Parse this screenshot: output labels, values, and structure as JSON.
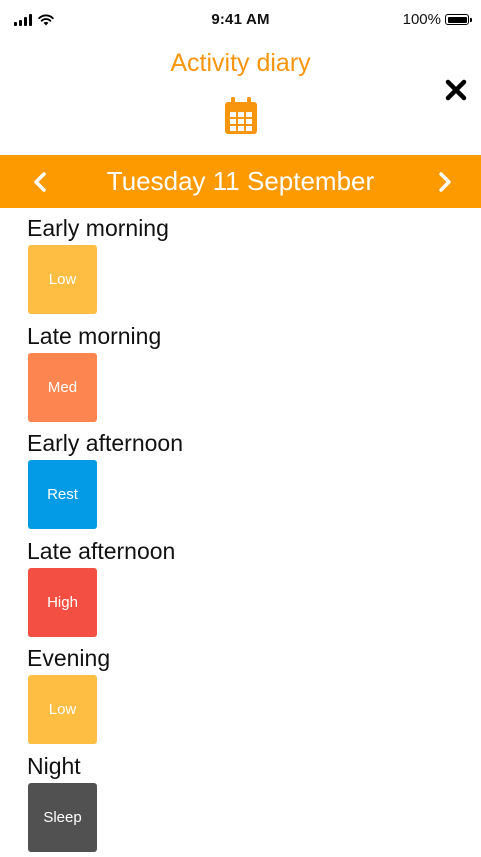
{
  "status_bar": {
    "time": "9:41 AM",
    "battery": "100%",
    "icons": [
      "signal-icon",
      "wifi-icon",
      "battery-icon"
    ]
  },
  "header": {
    "title": "Activity diary",
    "close_icon": "close-icon",
    "calendar_icon": "calendar-icon"
  },
  "date_nav": {
    "date": "Tuesday 11 September",
    "prev_icon": "chevron-left-icon",
    "next_icon": "chevron-right-icon"
  },
  "colors": {
    "accent": "#f7960e",
    "bar": "#fd9a00",
    "low": "#fdbe43",
    "med": "#fd8550",
    "rest": "#039be5",
    "high": "#f44f43",
    "sleep": "#515151"
  },
  "periods": [
    {
      "label": "Early morning",
      "level": "Low",
      "color": "#fdbe43"
    },
    {
      "label": "Late morning",
      "level": "Med",
      "color": "#fd8550"
    },
    {
      "label": "Early afternoon",
      "level": "Rest",
      "color": "#039be5"
    },
    {
      "label": "Late afternoon",
      "level": "High",
      "color": "#f44f43"
    },
    {
      "label": "Evening",
      "level": "Low",
      "color": "#fdbe43"
    },
    {
      "label": "Night",
      "level": "Sleep",
      "color": "#515151"
    }
  ]
}
